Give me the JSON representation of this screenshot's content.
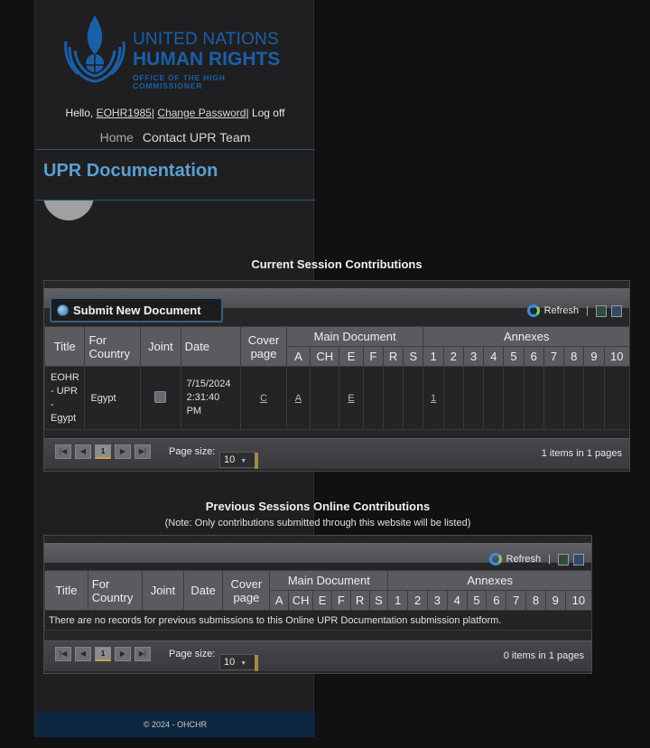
{
  "brand": {
    "line1": "UNITED NATIONS",
    "line2": "HUMAN RIGHTS",
    "line3": "OFFICE OF THE HIGH COMMISSIONER"
  },
  "user": {
    "hello": "Hello,",
    "username": "EOHR1985",
    "sep1": "|",
    "change_password": "Change Password",
    "sep2": "|",
    "logoff": "Log off"
  },
  "nav": {
    "home": "Home",
    "contact": "Contact UPR Team"
  },
  "page_title": "UPR Documentation",
  "current": {
    "title": "Current Session Contributions",
    "submit_label": "Submit New Document",
    "refresh_label": "Refresh",
    "columns": {
      "title": "Title",
      "for_country_1": "For",
      "for_country_2": "Country",
      "joint": "Joint",
      "date": "Date",
      "cover_1": "Cover",
      "cover_2": "page",
      "main": "Main Document",
      "annexes": "Annexes"
    },
    "main_langs": [
      "A",
      "CH",
      "E",
      "F",
      "R",
      "S"
    ],
    "annex_nums": [
      "1",
      "2",
      "3",
      "4",
      "5",
      "6",
      "7",
      "8",
      "9",
      "10"
    ],
    "row": {
      "title_lines": [
        "EOHR",
        "- UPR",
        "-",
        "Egypt"
      ],
      "country": "Egypt",
      "date_lines": [
        "7/15/2024",
        "2:31:40",
        "PM"
      ],
      "cover": "C",
      "main_a": "A",
      "main_e": "E",
      "annex_1": "1"
    },
    "pager": {
      "page": "1",
      "page_size_label": "Page size:",
      "page_size": "10",
      "info": "1 items in 1 pages"
    }
  },
  "previous": {
    "title": "Previous Sessions Online Contributions",
    "note": "(Note: Only contributions submitted through this website will be listed)",
    "refresh_label": "Refresh",
    "columns": {
      "title": "Title",
      "for_country_1": "For",
      "for_country_2": "Country",
      "joint": "Joint",
      "date": "Date",
      "cover_1": "Cover",
      "cover_2": "page",
      "main": "Main Document",
      "annexes": "Annexes"
    },
    "main_langs": [
      "A",
      "CH",
      "E",
      "F",
      "R",
      "S"
    ],
    "annex_nums": [
      "1",
      "2",
      "3",
      "4",
      "5",
      "6",
      "7",
      "8",
      "9",
      "10"
    ],
    "empty_message": "There are no records for previous submissions to this Online UPR Documentation submission platform.",
    "pager": {
      "page": "1",
      "page_size_label": "Page size:",
      "page_size": "10",
      "info": "0 items in 1 pages"
    }
  },
  "footer": "© 2024 - OHCHR",
  "colors": {
    "un_blue": "#1a5fa8",
    "title_blue": "#5aa0cf",
    "footer_bg": "#0d2740"
  },
  "icons": [
    "un-emblem-icon",
    "globe-icon",
    "refresh-icon",
    "export-excel-icon",
    "export-word-icon",
    "first-page-icon",
    "prev-page-icon",
    "next-page-icon",
    "last-page-icon",
    "dropdown-chevron-icon"
  ]
}
